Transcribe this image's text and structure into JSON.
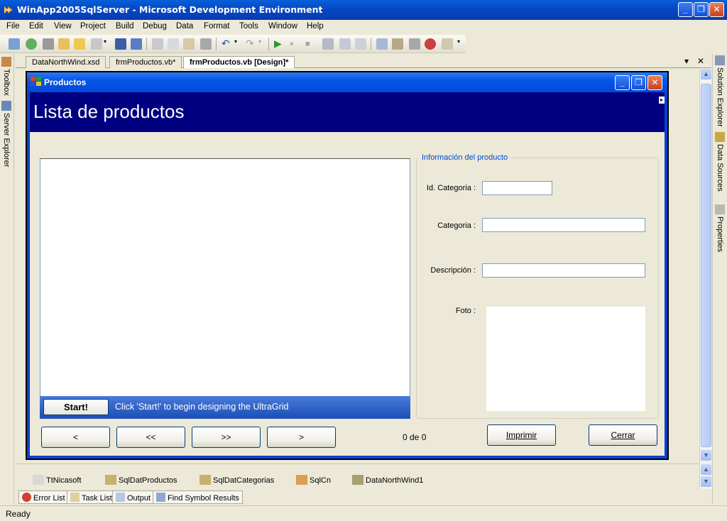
{
  "window": {
    "title": "WinApp2005SqlServer - Microsoft Development Environment",
    "minimize_glyph": "_",
    "maximize_glyph": "❐",
    "close_glyph": "✕"
  },
  "menu": [
    "File",
    "Edit",
    "View",
    "Project",
    "Build",
    "Debug",
    "Data",
    "Format",
    "Tools",
    "Window",
    "Help"
  ],
  "left_panels": {
    "toolbox": "Toolbox",
    "server_explorer": "Server Explorer"
  },
  "right_panels": {
    "solution_explorer": "Solution Explorer",
    "data_sources": "Data Sources",
    "properties": "Properties"
  },
  "doc_tabs": [
    {
      "label": "DataNorthWind.xsd",
      "active": false
    },
    {
      "label": "frmProductos.vb*",
      "active": false
    },
    {
      "label": "frmProductos.vb [Design]*",
      "active": true
    }
  ],
  "doc_controls": {
    "dropdown": "▾",
    "close": "✕"
  },
  "form": {
    "title": "Productos",
    "header": "Lista de productos",
    "grid": {
      "start_label": "Start!",
      "hint": "Click 'Start!' to begin designing the UltraGrid"
    },
    "group": {
      "title": "Información del producto",
      "labels": {
        "id_categoria": "Id. Categoria :",
        "categoria": "Categoria :",
        "descripcion": "Descripción :",
        "foto": "Foto :"
      }
    },
    "nav_buttons": {
      "prev": "<",
      "first": "<<",
      "last": ">>",
      "next": ">"
    },
    "counter": "0 de 0",
    "print_button": "Imprimir",
    "close_button": "Cerrar"
  },
  "component_tray": [
    "TtNicasoft",
    "SqlDatProductos",
    "SqlDatCategorias",
    "SqlCn",
    "DataNorthWind1"
  ],
  "tool_tabs": [
    "Error List",
    "Task List",
    "Output",
    "Find Symbol Results"
  ],
  "status": "Ready",
  "colors": {
    "form_header_band": "#000080",
    "xp_blue": "#0548c4",
    "group_title": "#0046d5"
  }
}
